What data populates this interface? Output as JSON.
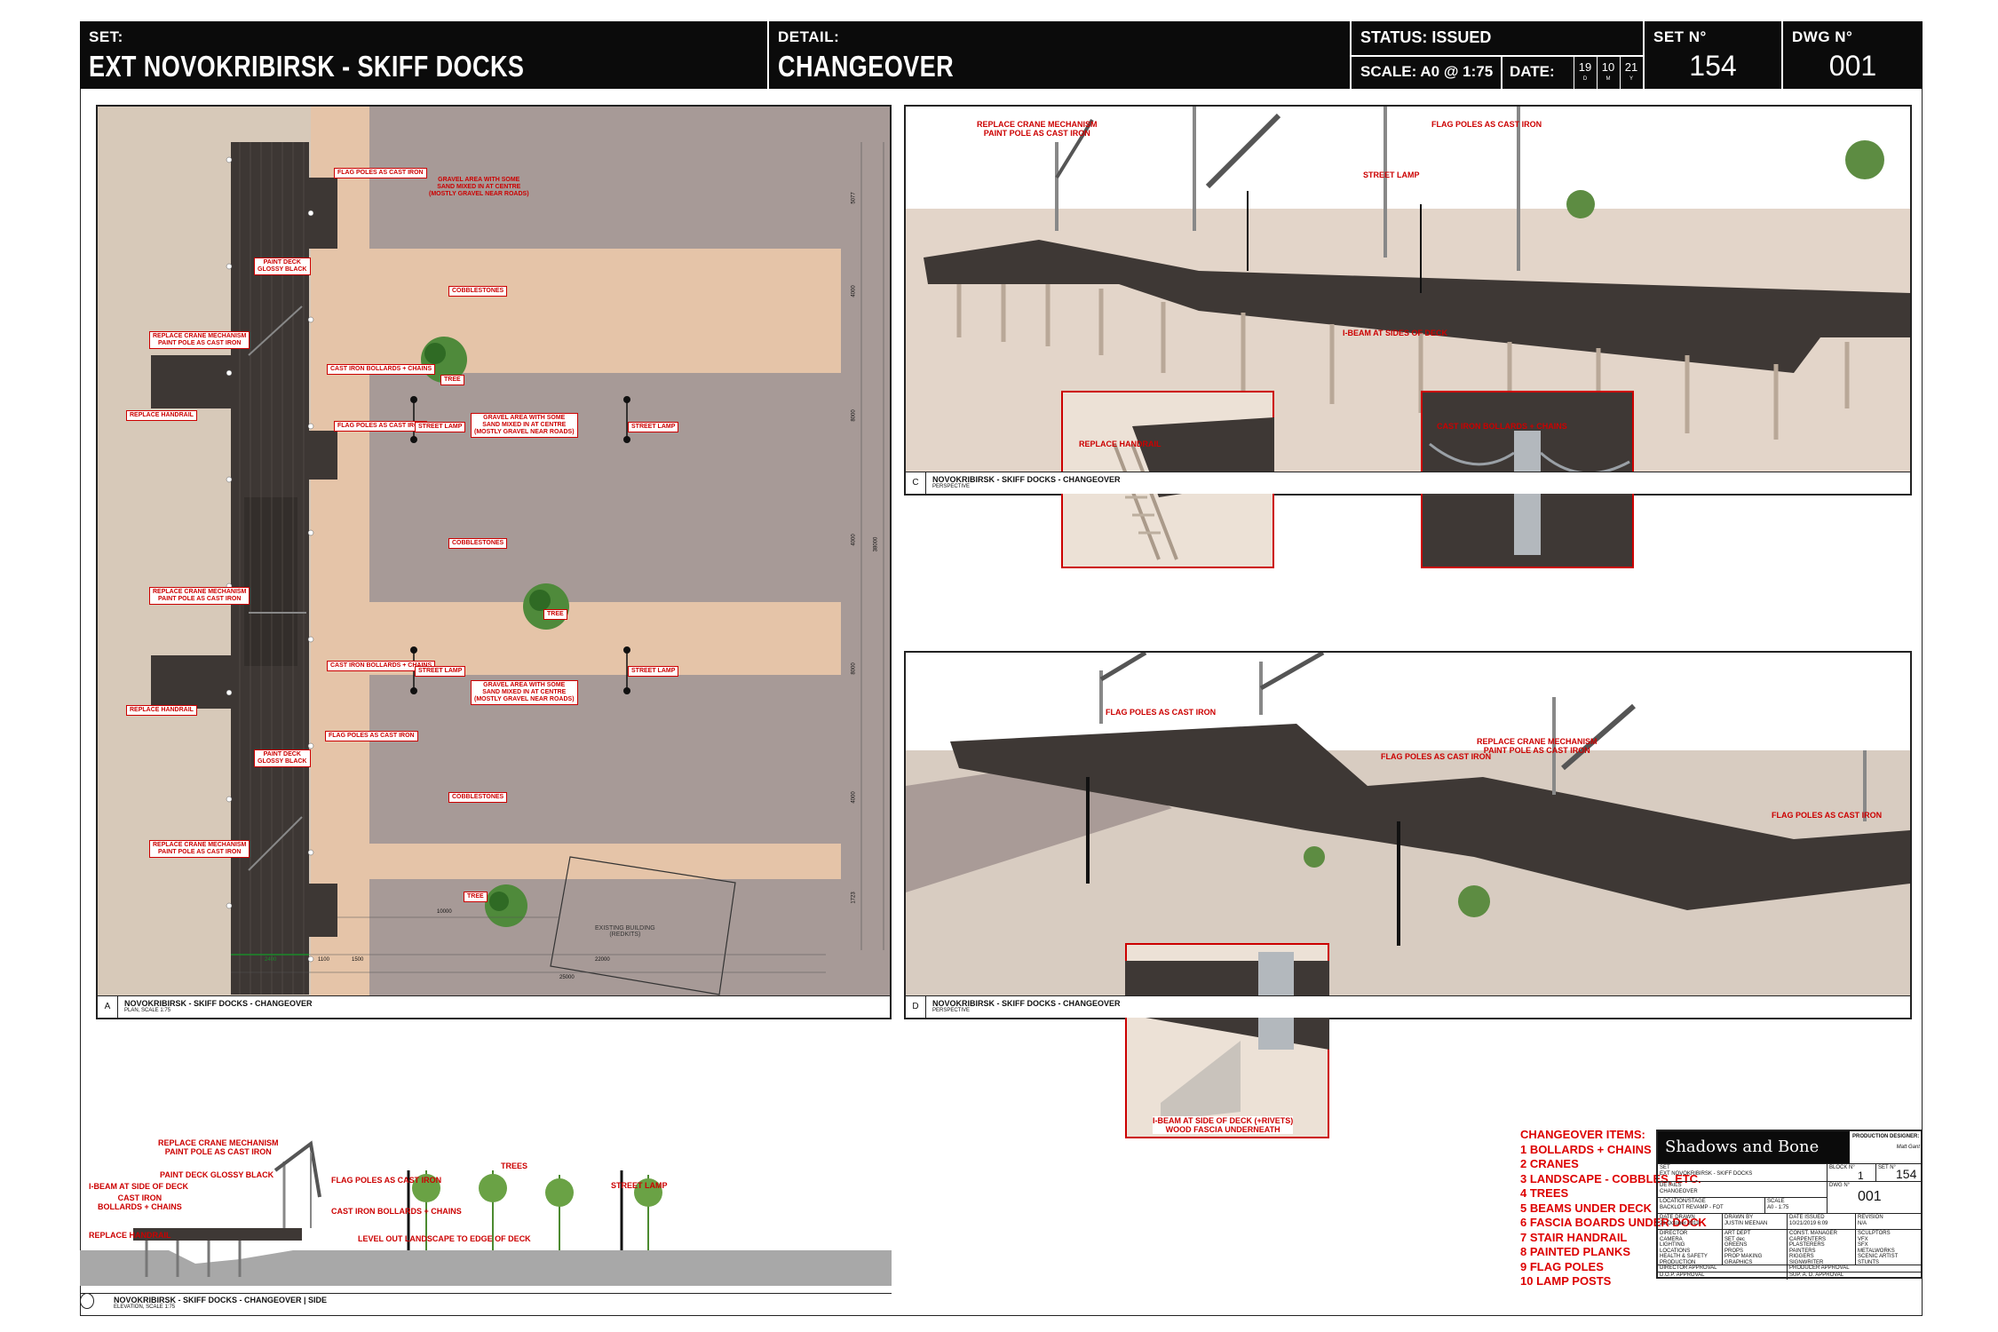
{
  "header": {
    "set_label": "SET:",
    "set_name": "EXT NOVOKRIBIRSK - SKIFF DOCKS",
    "detail_label": "DETAIL:",
    "detail_name": "CHANGEOVER",
    "status": "STATUS:  ISSUED",
    "scale": "SCALE:  A0 @ 1:75",
    "date_label": "DATE:",
    "date_d": "19",
    "date_m": "10",
    "date_y": "21",
    "date_d_s": "D",
    "date_m_s": "M",
    "date_y_s": "Y",
    "set_no_label": "SET N°",
    "set_no": "154",
    "dwg_no_label": "DWG N°",
    "dwg_no": "001"
  },
  "panel_a": {
    "letter": "A",
    "title": "NOVOKRIBIRSK - SKIFF DOCKS - CHANGEOVER",
    "subtitle": "PLAN, SCALE 1:75",
    "notes": {
      "flag1": "FLAG POLES AS CAST IRON",
      "gravel1": "GRAVEL AREA WITH SOME\nSAND MIXED IN AT CENTRE\n(MOSTLY GRAVEL NEAR ROADS)",
      "paint1": "PAINT DECK\nGLOSSY BLACK",
      "cobbles1": "COBBLESTONES",
      "crane1": "REPLACE CRANE MECHANISM\nPAINT POLE AS CAST IRON",
      "bollards1": "CAST IRON BOLLARDS + CHAINS",
      "tree1": "TREE",
      "handrail1": "REPLACE HANDRAIL",
      "flag2": "FLAG POLES AS CAST IRON",
      "lamp1": "STREET LAMP",
      "gravel2": "GRAVEL AREA WITH SOME\nSAND MIXED IN AT CENTRE\n(MOSTLY GRAVEL NEAR ROADS)",
      "lamp2": "STREET LAMP",
      "cobbles2": "COBBLESTONES",
      "crane2": "REPLACE CRANE MECHANISM\nPAINT POLE AS CAST IRON",
      "tree2": "TREE",
      "bollards2": "CAST IRON BOLLARDS + CHAINS",
      "handrail2": "REPLACE HANDRAIL",
      "lamp3": "STREET LAMP",
      "lamp4": "STREET LAMP",
      "gravel3": "GRAVEL AREA WITH SOME\nSAND MIXED IN AT CENTRE\n(MOSTLY GRAVEL NEAR ROADS)",
      "flag3": "FLAG POLES AS CAST IRON",
      "paint2": "PAINT DECK\nGLOSSY BLACK",
      "cobbles3": "COBBLESTONES",
      "crane3": "REPLACE CRANE MECHANISM\nPAINT POLE AS CAST IRON",
      "tree3": "TREE",
      "existing": "EXISTING BUILDING\n(REDKITS)"
    },
    "dims": {
      "d5077": "5077",
      "d4000a": "4000",
      "d8000a": "8000",
      "d4000b": "4000",
      "d8000b": "8000",
      "d4000c": "4000",
      "d1723": "1723",
      "d38000": "38000",
      "d10000": "10000",
      "d2400": "2400",
      "d1100": "1100",
      "d1500": "1500",
      "d22000": "22000",
      "d25000": "25000"
    }
  },
  "panel_c": {
    "letter": "C",
    "title": "NOVOKRIBIRSK - SKIFF DOCKS - CHANGEOVER",
    "subtitle": "PERSPECTIVE",
    "labels": {
      "crane": "REPLACE CRANE MECHANISM\nPAINT POLE AS CAST IRON",
      "flag": "FLAG POLES AS CAST IRON",
      "lamp": "STREET LAMP",
      "ibeam": "I-BEAM AT SIDES OF DECK",
      "handrail": "REPLACE HANDRAIL",
      "bollards": "CAST IRON BOLLARDS + CHAINS"
    }
  },
  "panel_d": {
    "letter": "D",
    "title": "NOVOKRIBIRSK - SKIFF DOCKS - CHANGEOVER",
    "subtitle": "PERSPECTIVE",
    "labels": {
      "flag1": "FLAG POLES AS CAST IRON",
      "flag2": "FLAG POLES AS CAST IRON",
      "crane": "REPLACE CRANE MECHANISM\nPAINT POLE AS CAST IRON",
      "flag3": "FLAG POLES AS CAST IRON",
      "ibeam": "I-BEAM AT SIDE OF DECK (+RIVETS)\nWOOD FASCIA UNDERNEATH"
    }
  },
  "panel_b": {
    "title": "NOVOKRIBIRSK - SKIFF DOCKS - CHANGEOVER | SIDE",
    "subtitle": "ELEVATION, SCALE 1:75",
    "labels": {
      "crane": "REPLACE CRANE MECHANISM\nPAINT POLE AS CAST IRON",
      "paint": "PAINT DECK GLOSSY BLACK",
      "ibeam": "I-BEAM AT SIDE OF DECK",
      "bollards": "CAST IRON\nBOLLARDS + CHAINS",
      "handrail": "REPLACE HANDRAIL",
      "flag": "FLAG POLES AS CAST IRON",
      "bollards2": "CAST IRON BOLLARDS + CHAINS",
      "level": "LEVEL OUT LANDSCAPE TO EDGE OF DECK",
      "trees": "TREES",
      "lamp": "STREET LAMP"
    }
  },
  "changeover": {
    "heading": "CHANGEOVER ITEMS:",
    "items": [
      "1 BOLLARDS + CHAINS",
      "2 CRANES",
      "3 LANDSCAPE - COBBLES, ETC.",
      "4 TREES",
      "5 BEAMS UNDER DECK",
      "6 FASCIA BOARDS UNDER DOCK",
      "7 STAIR HANDRAIL",
      "8 PAINTED PLANKS",
      "9 FLAG POLES",
      "10 LAMP POSTS"
    ]
  },
  "title_block": {
    "logo": "Shadows and Bone",
    "pd_label": "PRODUCTION DESIGNER:",
    "pd_name": "Matt Gant",
    "set_label": "SET",
    "set_value": "EXT NOVOKRIBIRSK - SKIFF DOCKS",
    "block_label": "BLOCK N°",
    "block_value": "1",
    "setn_label": "SET N°",
    "setn_value": "154",
    "details_label": "DETAILS",
    "details_value": "CHANGEOVER",
    "dwg_label": "DWG N°",
    "dwg_value": "001",
    "loc_label": "LOCATION/STAGE",
    "loc_value": "BACKLOT REVAMP - FOT",
    "scale_label": "SCALE",
    "scale_value": "A0 - 1:75",
    "date_drawn_label": "DATE DRAWN",
    "date_drawn_value": "21 October 2019",
    "drawn_by_label": "DRAWN BY",
    "drawn_by_value": "JUSTIN MEENAN",
    "date_issued_label": "DATE ISSUED",
    "date_issued_value": "10/21/2019 6:09",
    "revision_label": "REVISION",
    "revision_value": "N/A",
    "dist": [
      [
        "DIRECTOR",
        "ART DEPT",
        "CONST. MANAGER",
        "SCULPTORS"
      ],
      [
        "CAMERA",
        "SET dec",
        "CARPENTERS",
        "VFX"
      ],
      [
        "LIGHTING",
        "GREENS",
        "PLASTERERS",
        "SFX"
      ],
      [
        "LOCATIONS",
        "PROPS",
        "PAINTERS",
        "METALWORKS"
      ],
      [
        "HEALTH & SAFETY",
        "PROP MAKING",
        "RIGGERS",
        "SCENIC ARTIST"
      ],
      [
        "PRODUCTION",
        "GRAPHICS",
        "SIGNWRITER",
        "STUNTS"
      ]
    ],
    "director_approval": "DIRECTOR APPROVAL",
    "producer_approval": "PRODUCER APPROVAL",
    "dop_approval": "D.O.P. APPROVAL",
    "supad_approval": "SUP. A. D. APPROVAL"
  }
}
